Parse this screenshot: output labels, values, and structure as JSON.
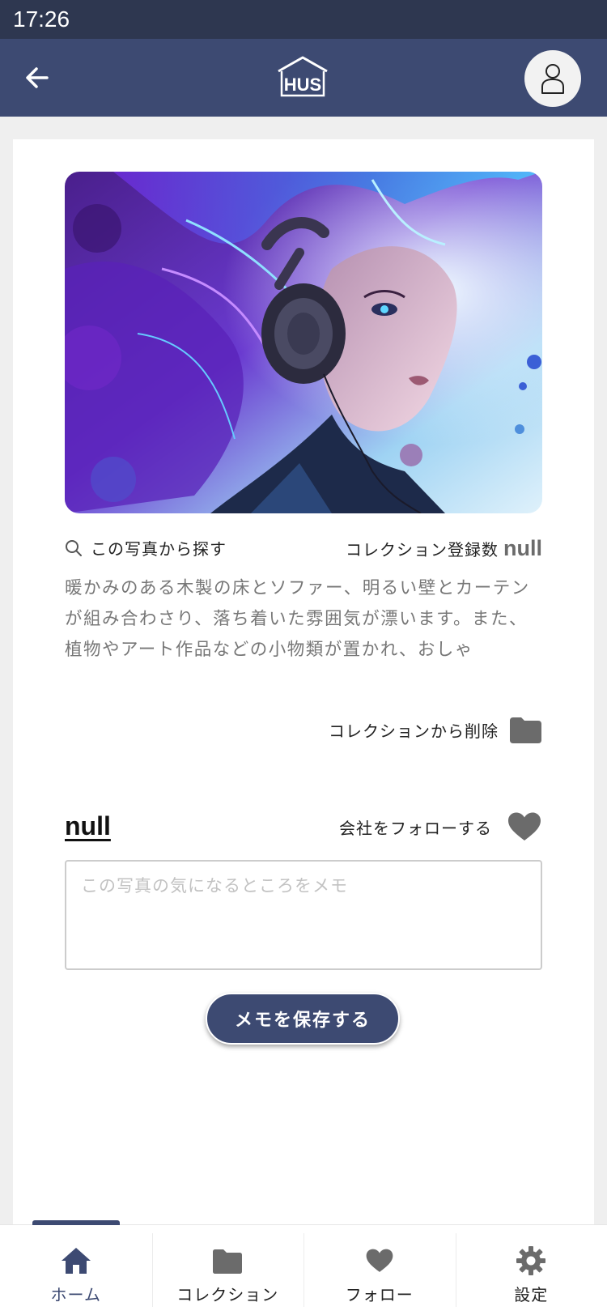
{
  "status_bar": {
    "time": "17:26"
  },
  "header": {
    "logo_text": "HUS",
    "back_icon": "arrow-left-icon",
    "profile_icon": "user-icon"
  },
  "photo": {
    "alt": "woman-with-headphones-illustration",
    "search_label": "この写真から探す",
    "collection_count_label": "コレクション登録数",
    "collection_count_value": "null",
    "description": "暖かみのある木製の床とソファー、明るい壁とカーテンが組み合わさり、落ち着いた雰囲気が漂います。また、植物やアート作品などの小物類が置かれ、おしゃ",
    "remove_from_collection_label": "コレクションから削除"
  },
  "company": {
    "name": "null",
    "follow_label": "会社をフォローする"
  },
  "memo": {
    "value": "",
    "placeholder": "この写真の気になるところをメモ",
    "save_label": "メモを保存する"
  },
  "tabs": [
    {
      "label": "ホーム",
      "icon": "home-icon",
      "active": true
    },
    {
      "label": "コレクション",
      "icon": "folder-icon",
      "active": false
    },
    {
      "label": "フォロー",
      "icon": "heart-icon",
      "active": false
    },
    {
      "label": "設定",
      "icon": "gear-icon",
      "active": false
    }
  ],
  "colors": {
    "header_bg": "#3d4a72",
    "status_bar_bg": "#2e3750",
    "accent": "#3d4a72",
    "icon_gray": "#6b6b6b"
  }
}
